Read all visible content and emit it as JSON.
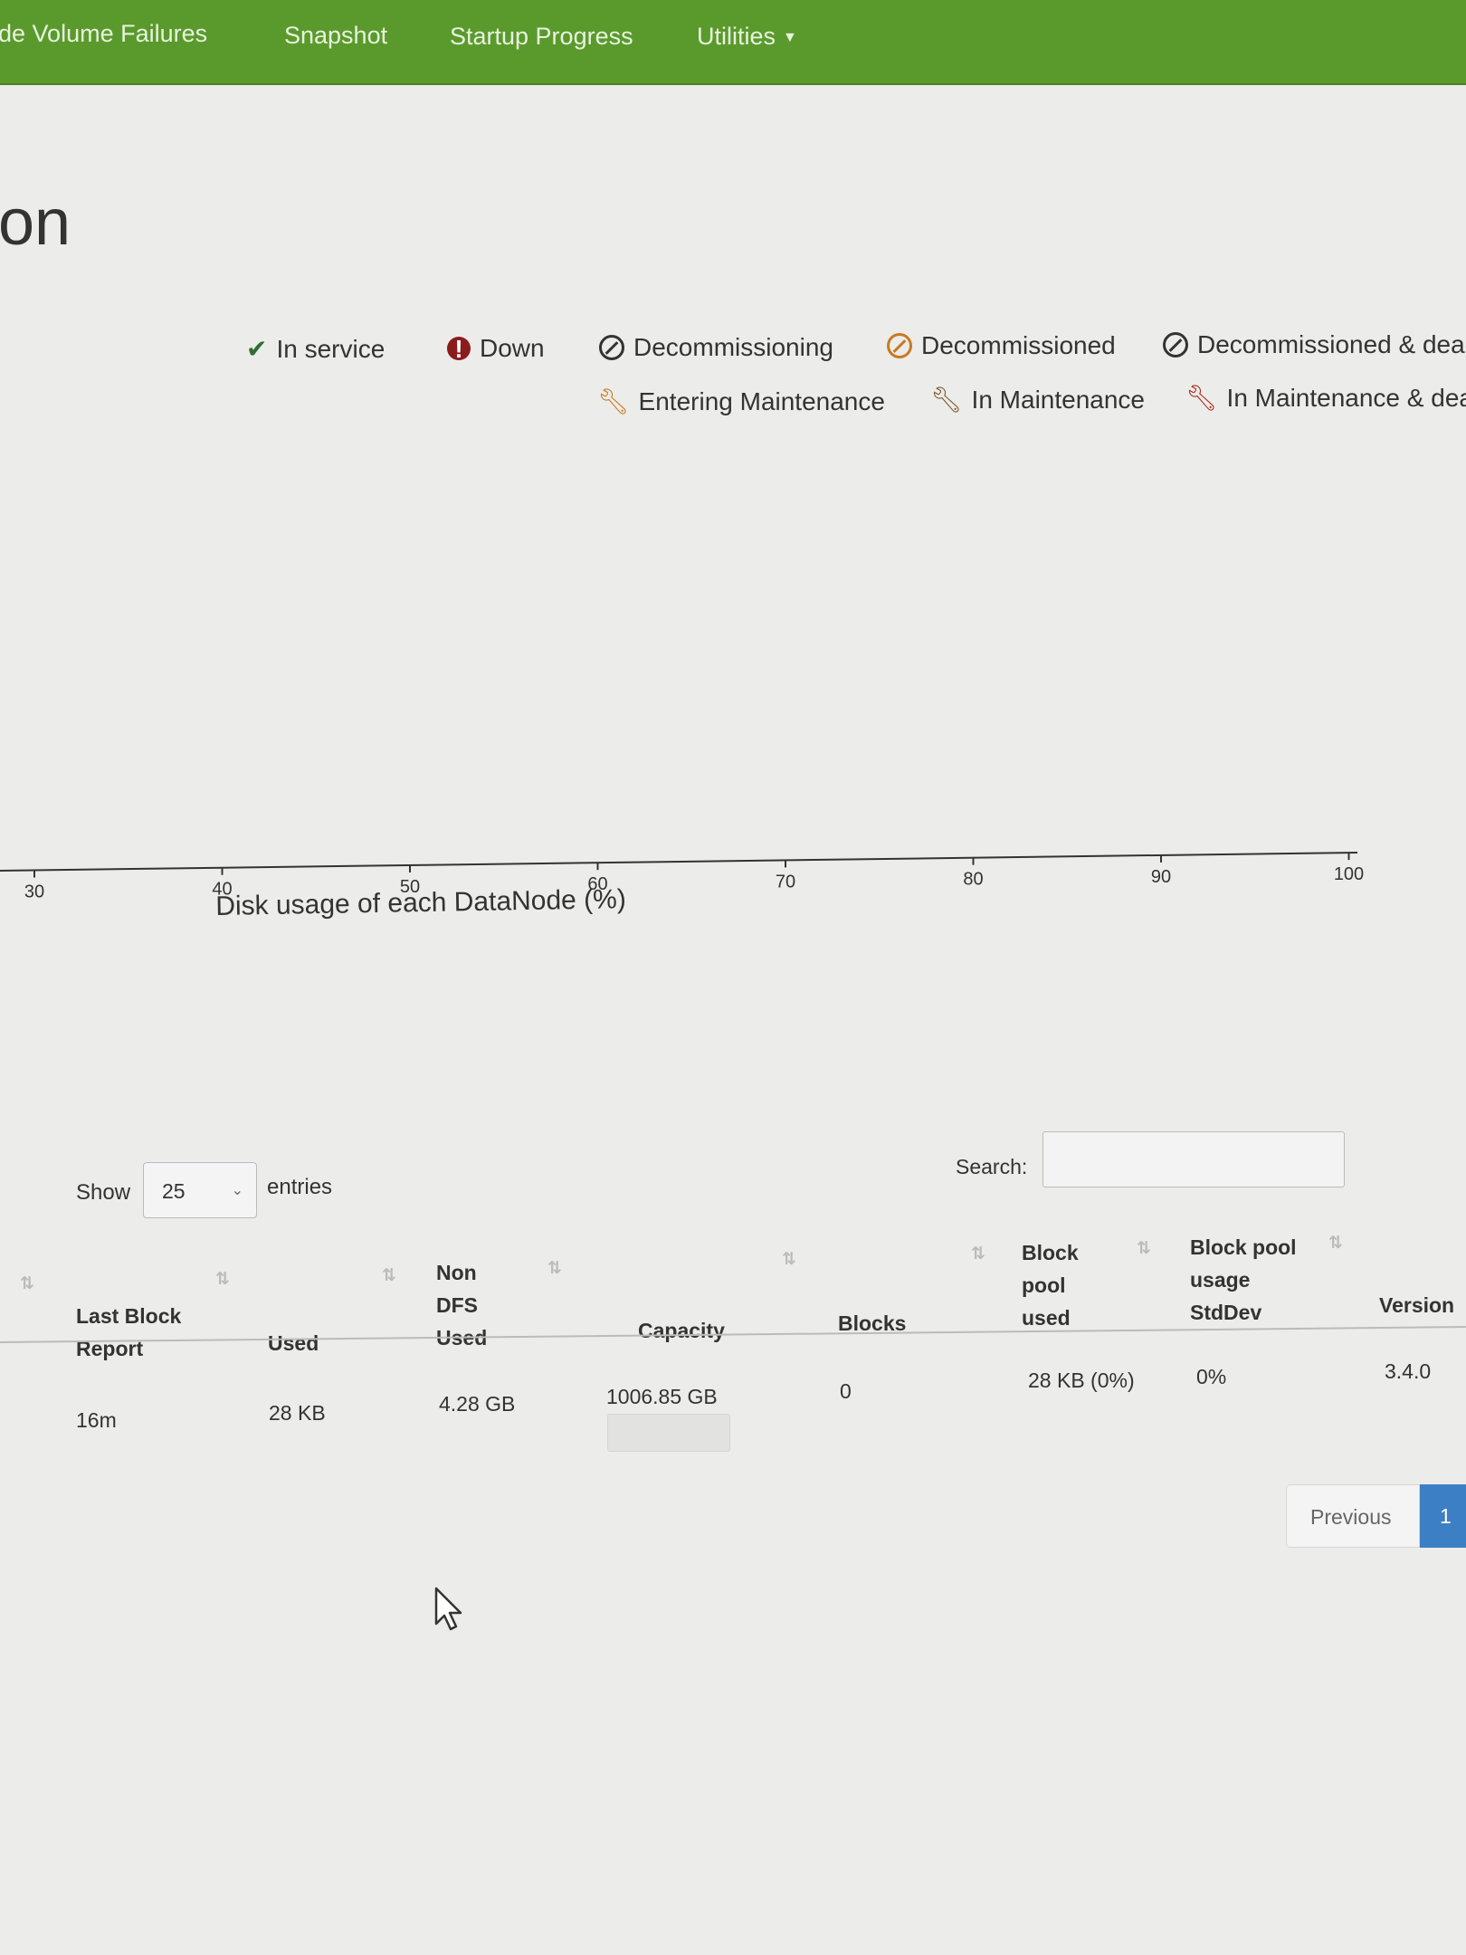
{
  "navbar": {
    "items": [
      {
        "label": "de Volume Failures"
      },
      {
        "label": "Snapshot"
      },
      {
        "label": "Startup Progress"
      },
      {
        "label": "Utilities"
      }
    ]
  },
  "page_title": "on",
  "legend": {
    "in_service": "In service",
    "down": "Down",
    "decommissioning": "Decommissioning",
    "decommissioned": "Decommissioned",
    "decommissioned_dead": "Decommissioned & dead",
    "entering_maintenance": "Entering Maintenance",
    "in_maintenance": "In Maintenance",
    "in_maintenance_dead": "In Maintenance & dead"
  },
  "chart_data": {
    "type": "bar",
    "xlabel": "Disk usage of each DataNode (%)",
    "ticks": [
      "30",
      "40",
      "50",
      "60",
      "70",
      "80",
      "90",
      "100"
    ],
    "values": []
  },
  "controls": {
    "show_label": "Show",
    "show_value": "25",
    "entries_label": "entries",
    "search_label": "Search:"
  },
  "table": {
    "headers": {
      "last_block_report": [
        "Last Block",
        "Report"
      ],
      "used": "Used",
      "non_dfs_used": [
        "Non",
        "DFS",
        "Used"
      ],
      "capacity": "Capacity",
      "blocks": "Blocks",
      "block_pool_used": [
        "Block",
        "pool",
        "used"
      ],
      "block_pool_stddev": [
        "Block pool",
        "usage",
        "StdDev"
      ],
      "version": "Version"
    },
    "rows": [
      {
        "last_block_report": "16m",
        "used": "28 KB",
        "non_dfs_used": "4.28 GB",
        "capacity": "1006.85 GB",
        "blocks": "0",
        "block_pool_used": "28 KB (0%)",
        "block_pool_stddev": "0%",
        "version": "3.4.0"
      }
    ]
  },
  "pagination": {
    "previous": "Previous",
    "current": "1"
  },
  "colors": {
    "navbar": "#5a9a2c",
    "active_page": "#3d7fc4"
  }
}
